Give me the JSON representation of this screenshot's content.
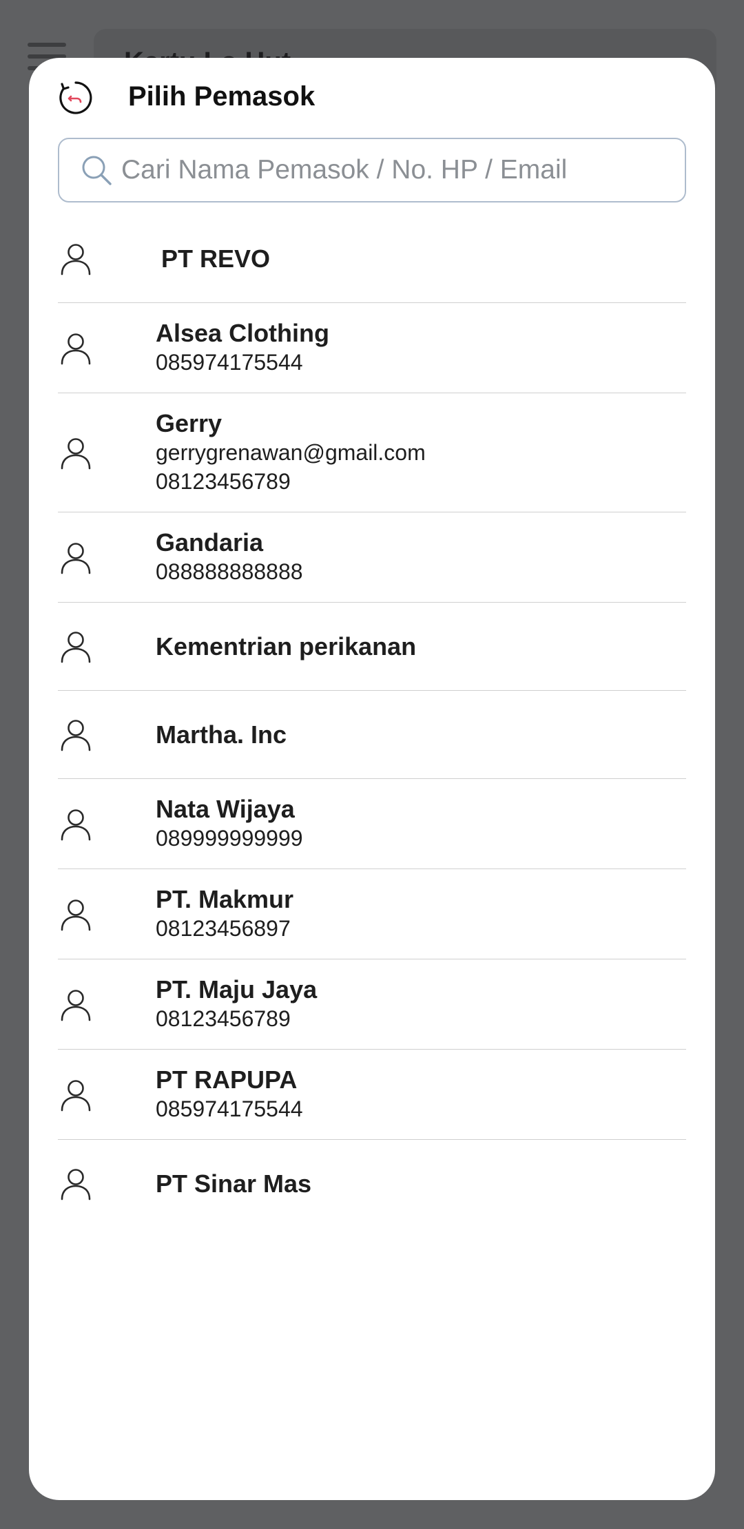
{
  "background": {
    "title": "Kartu Lo Hut"
  },
  "header": {
    "title": "Pilih Pemasok",
    "back_icon": "back-icon"
  },
  "search": {
    "placeholder": "Cari Nama Pemasok / No. HP / Email",
    "value": ""
  },
  "suppliers": [
    {
      "name": "PT REVO"
    },
    {
      "name": "Alsea Clothing",
      "phone": "085974175544"
    },
    {
      "name": "Gerry",
      "email": "gerrygrenawan@gmail.com",
      "phone": "08123456789"
    },
    {
      "name": "Gandaria",
      "phone": "088888888888"
    },
    {
      "name": "Kementrian perikanan"
    },
    {
      "name": "Martha. Inc"
    },
    {
      "name": "Nata Wijaya",
      "phone": "089999999999"
    },
    {
      "name": "PT. Makmur",
      "phone": "08123456897"
    },
    {
      "name": "PT. Maju Jaya",
      "phone": "08123456789"
    },
    {
      "name": "PT RAPUPA",
      "phone": "085974175544"
    },
    {
      "name": "PT Sinar Mas"
    }
  ],
  "colors": {
    "overlay": "#5f6062",
    "accent": "#e2475c",
    "search_border": "#aebccd"
  }
}
